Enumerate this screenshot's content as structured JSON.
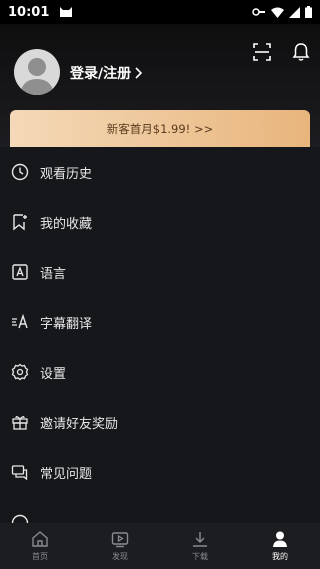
{
  "status_bar": {
    "time": "10:01"
  },
  "profile": {
    "login_label": "登录/注册"
  },
  "promo": {
    "text": "新客首月$1.99!  >>"
  },
  "menu": {
    "items": [
      {
        "label": "观看历史",
        "icon": "clock-icon"
      },
      {
        "label": "我的收藏",
        "icon": "bookmark-icon"
      },
      {
        "label": "语言",
        "icon": "language-icon"
      },
      {
        "label": "字幕翻译",
        "icon": "subtitle-translate-icon"
      },
      {
        "label": "设置",
        "icon": "gear-icon"
      },
      {
        "label": "邀请好友奖励",
        "icon": "gift-icon"
      },
      {
        "label": "常见问题",
        "icon": "chat-bubbles-icon"
      }
    ]
  },
  "tabs": [
    {
      "label": "首页",
      "icon": "home-icon",
      "active": false
    },
    {
      "label": "发现",
      "icon": "play-screen-icon",
      "active": false
    },
    {
      "label": "下载",
      "icon": "download-icon",
      "active": false
    },
    {
      "label": "我的",
      "icon": "user-icon",
      "active": true
    }
  ],
  "colors": {
    "accent_gold_start": "#f4d9b8",
    "accent_gold_end": "#e8b57c",
    "background": "#16171b"
  }
}
